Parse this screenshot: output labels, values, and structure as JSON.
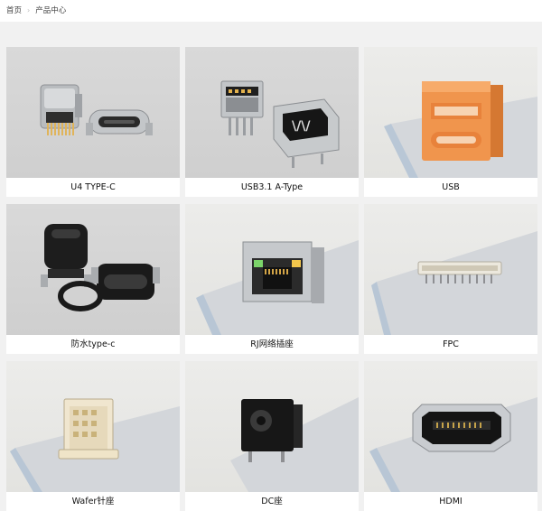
{
  "breadcrumb": {
    "home": "首页",
    "separator": "›",
    "current": "产品中心"
  },
  "products": [
    {
      "label": "U4 TYPE-C",
      "icon": "usb-c-connector-icon"
    },
    {
      "label": "USB3.1 A-Type",
      "icon": "usb-a-connector-icon"
    },
    {
      "label": "USB",
      "icon": "usb-orange-connector-icon"
    },
    {
      "label": "防水type-c",
      "icon": "waterproof-usb-c-icon"
    },
    {
      "label": "RJ网络插座",
      "icon": "rj45-jack-icon"
    },
    {
      "label": "FPC",
      "icon": "fpc-connector-icon"
    },
    {
      "label": "Wafer针座",
      "icon": "wafer-header-icon"
    },
    {
      "label": "DC座",
      "icon": "dc-jack-icon"
    },
    {
      "label": "HDMI",
      "icon": "hdmi-connector-icon"
    }
  ]
}
